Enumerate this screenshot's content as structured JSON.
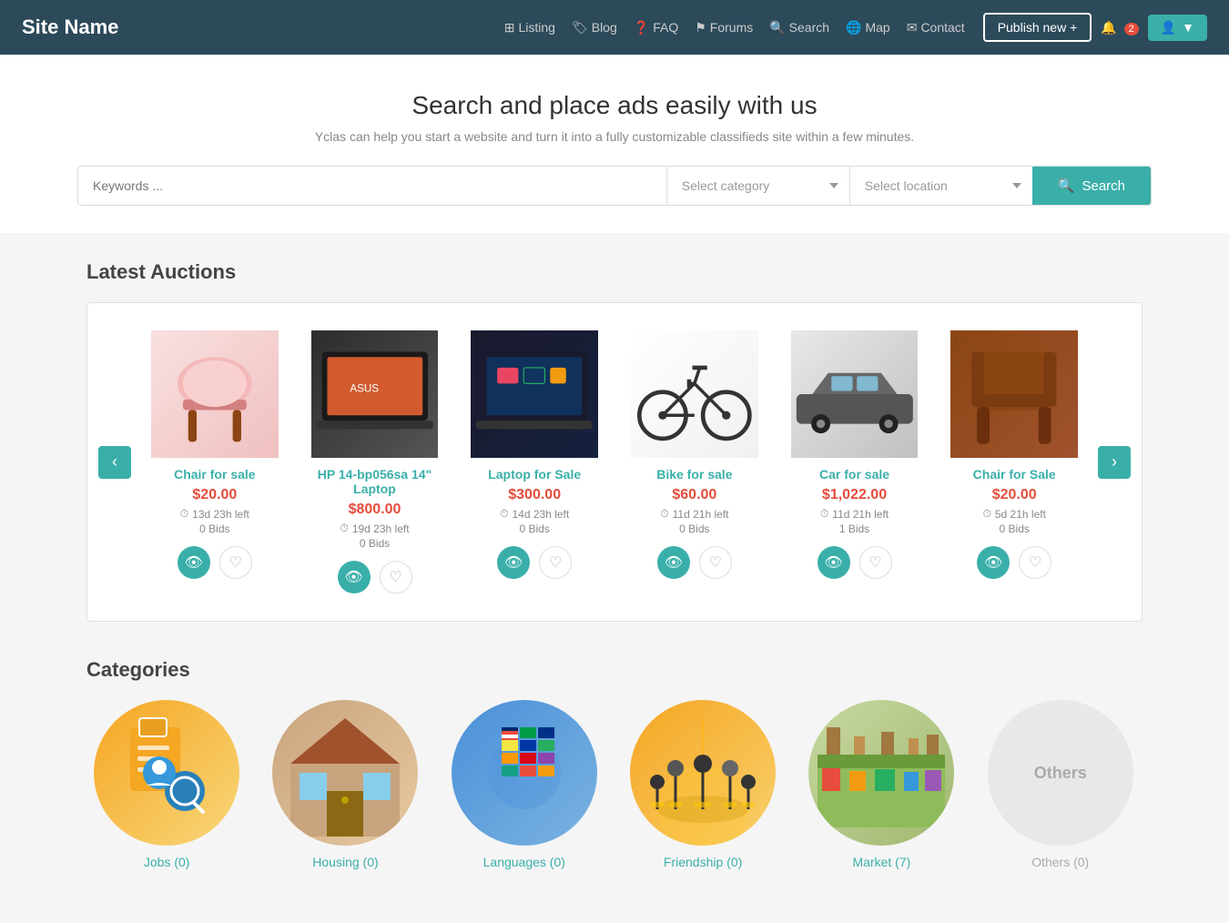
{
  "site": {
    "name": "Site Name"
  },
  "navbar": {
    "links": [
      {
        "label": "Listing",
        "icon": "listing-icon"
      },
      {
        "label": "Blog",
        "icon": "blog-icon"
      },
      {
        "label": "FAQ",
        "icon": "faq-icon"
      },
      {
        "label": "Forums",
        "icon": "forums-icon"
      },
      {
        "label": "Search",
        "icon": "search-icon"
      },
      {
        "label": "Map",
        "icon": "map-icon"
      },
      {
        "label": "Contact",
        "icon": "contact-icon"
      }
    ],
    "publish_btn": "Publish new +",
    "notif_count": "2",
    "user_label": "▼"
  },
  "hero": {
    "title": "Search and place ads easily with us",
    "subtitle": "Yclas can help you start a website and turn it into a fully customizable classifieds site within a few minutes.",
    "search_placeholder": "Keywords ...",
    "category_placeholder": "Select category",
    "location_placeholder": "Select location",
    "search_btn": "Search"
  },
  "auctions": {
    "section_title": "Latest Auctions",
    "items": [
      {
        "title": "Chair for sale",
        "price": "$20.00",
        "time": "13d 23h left",
        "bids": "0 Bids",
        "img_class": "img-chair"
      },
      {
        "title": "HP 14-bp056sa 14\" Laptop",
        "price": "$800.00",
        "time": "19d 23h left",
        "bids": "0 Bids",
        "img_class": "img-laptop"
      },
      {
        "title": "Laptop for Sale",
        "price": "$300.00",
        "time": "14d 23h left",
        "bids": "0 Bids",
        "img_class": "img-laptop2"
      },
      {
        "title": "Bike for sale",
        "price": "$60.00",
        "time": "11d 21h left",
        "bids": "0 Bids",
        "img_class": "img-bike"
      },
      {
        "title": "Car for sale",
        "price": "$1,022.00",
        "time": "11d 21h left",
        "bids": "1 Bids",
        "img_class": "img-car"
      },
      {
        "title": "Chair for Sale",
        "price": "$20.00",
        "time": "5d 21h left",
        "bids": "0 Bids",
        "img_class": "img-chair2"
      }
    ]
  },
  "categories": {
    "section_title": "Categories",
    "items": [
      {
        "label": "Jobs (0)",
        "img_class": "cat-jobs",
        "icon": "jobs-icon"
      },
      {
        "label": "Housing (0)",
        "img_class": "cat-housing",
        "icon": "housing-icon"
      },
      {
        "label": "Languages (0)",
        "img_class": "cat-languages",
        "icon": "languages-icon"
      },
      {
        "label": "Friendship (0)",
        "img_class": "cat-friendship",
        "icon": "friendship-icon"
      },
      {
        "label": "Market (7)",
        "img_class": "cat-market",
        "icon": "market-icon"
      },
      {
        "label": "Others (0)",
        "img_class": "cat-others",
        "icon": "others-icon",
        "text_only": "Others"
      }
    ]
  }
}
